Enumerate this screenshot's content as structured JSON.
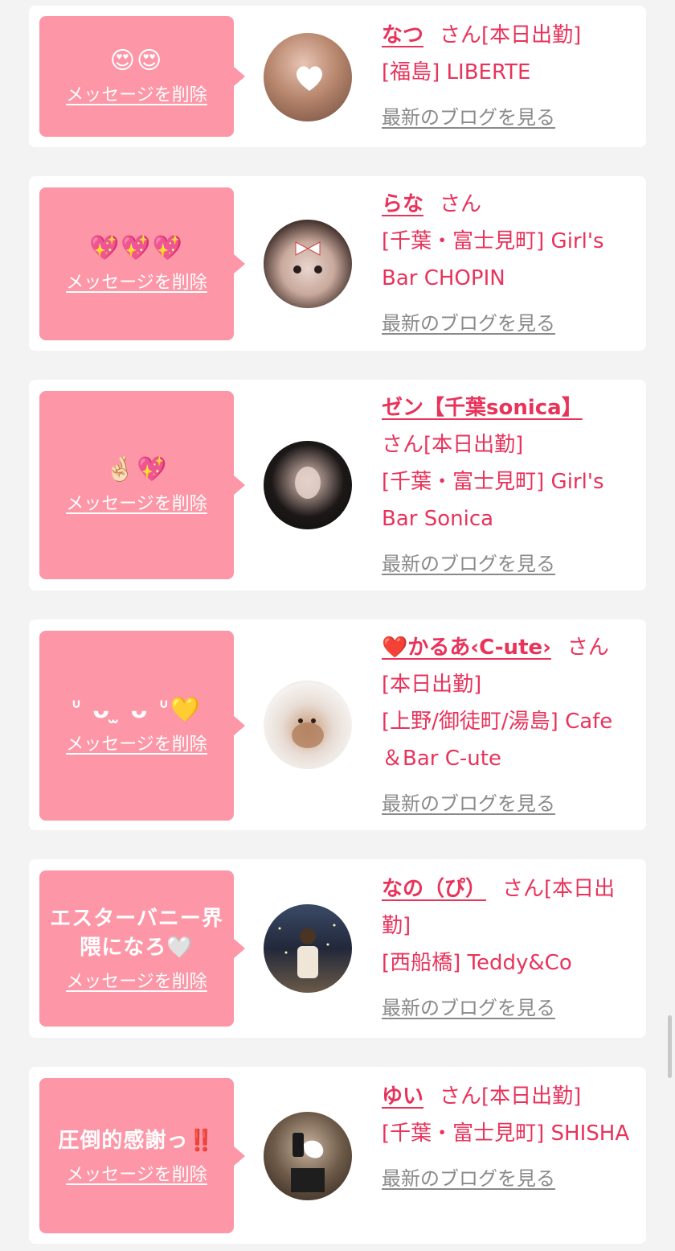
{
  "common": {
    "delete_label": "メッセージを削除",
    "blog_label": "最新のブログを見る",
    "san": "さん",
    "accent_color": "#e8335b",
    "bubble_color": "#fd96a6"
  },
  "items": [
    {
      "message": "😍😍",
      "name": "なつ",
      "status": "[本日出勤]",
      "shop": "[福島] LIBERTE"
    },
    {
      "message": "💖💖💖",
      "name": "らな",
      "status": "",
      "shop": "[千葉・富士見町] Girl's Bar CHOPIN"
    },
    {
      "message": "🤞🏻💖",
      "name": "ゼン【千葉sonica】",
      "status": "[本日出勤]",
      "shop": "[千葉・富士見町] Girl's Bar Sonica"
    },
    {
      "message": "ᐡ ᴗ ̫ ᴗ ᐡ💛",
      "name": "❤️かるあ‹C-ute›",
      "status": "[本日出勤]",
      "shop": "[上野/御徒町/湯島] Cafe ＆Bar C-ute"
    },
    {
      "message": "エスターバニー界隈になろ🤍",
      "name": "なの（ぴ）",
      "status": "[本日出勤]",
      "shop": "[西船橋] Teddy&Co"
    },
    {
      "message": "圧倒的感謝っ‼️",
      "name": "ゆい",
      "status": "[本日出勤]",
      "shop": "[千葉・富士見町] SHISHA"
    }
  ]
}
